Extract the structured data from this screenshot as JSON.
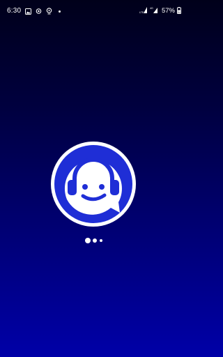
{
  "status_bar": {
    "time": "6:30",
    "network_labels": [
      "LTE",
      "4G"
    ],
    "battery_percent": "57%",
    "left_icons": [
      "gallery-icon",
      "sync-icon",
      "location-icon"
    ],
    "right_icons": [
      "signal-icon",
      "signal-icon",
      "battery-icon"
    ]
  },
  "splash": {
    "logo": "headset-smiley-chat-logo",
    "colors": {
      "accent": "#1f2ed6",
      "ring": "#ffffff",
      "background_top": "#00001a",
      "background_bottom": "#0000a8"
    },
    "loading_dots": 3
  }
}
